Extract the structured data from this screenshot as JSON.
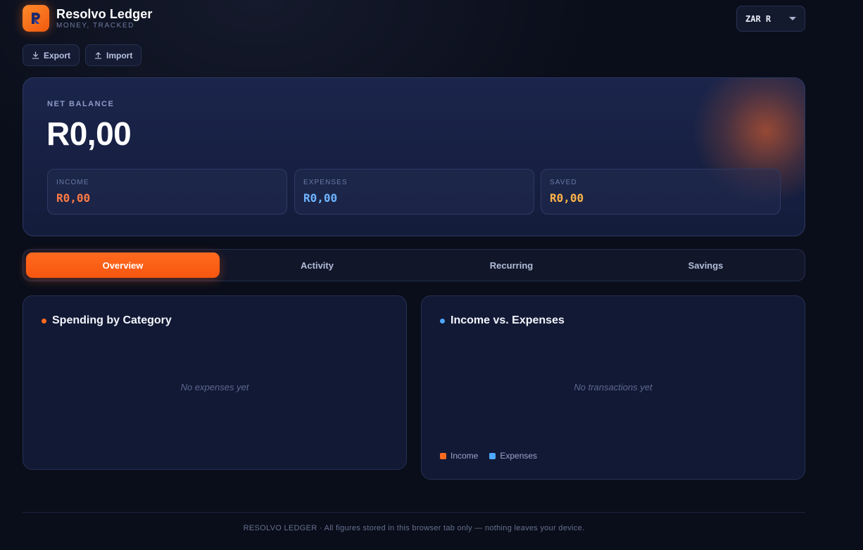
{
  "app": {
    "name": "Resolvo Ledger",
    "tagline": "MONEY, TRACKED",
    "logo_icon": "r-logo-icon",
    "brand_color": "#ff6a1f"
  },
  "currency": {
    "selected": "ZAR R",
    "icon": "chevron-down-icon"
  },
  "actions": {
    "export_label": "Export",
    "export_icon": "download-icon",
    "import_label": "Import",
    "import_icon": "upload-icon"
  },
  "balance": {
    "net_label": "NET BALANCE",
    "net_value": "R0,00",
    "stats": [
      {
        "label": "INCOME",
        "value": "R0,00",
        "color": "#ff7a45"
      },
      {
        "label": "EXPENSES",
        "value": "R0,00",
        "color": "#6fb4ff"
      },
      {
        "label": "SAVED",
        "value": "R0,00",
        "color": "#ffb347"
      }
    ]
  },
  "tabs": [
    {
      "label": "Overview",
      "active": true
    },
    {
      "label": "Activity",
      "active": false
    },
    {
      "label": "Recurring",
      "active": false
    },
    {
      "label": "Savings",
      "active": false
    }
  ],
  "panels": {
    "spending": {
      "title": "Spending by Category",
      "dot_color": "#ff6a1f",
      "empty_text": "No expenses yet"
    },
    "income_vs_expenses": {
      "title": "Income vs. Expenses",
      "dot_color": "#4ea8ff",
      "empty_text": "No transactions yet",
      "legend": [
        {
          "label": "Income",
          "color": "#ff6a1f"
        },
        {
          "label": "Expenses",
          "color": "#4ea8ff"
        }
      ]
    }
  },
  "footer": {
    "text": "RESOLVO LEDGER · All figures stored in this browser tab only — nothing leaves your device."
  }
}
